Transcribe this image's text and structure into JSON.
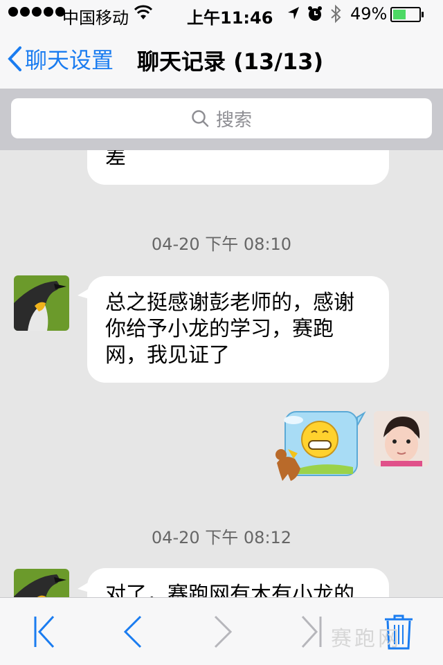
{
  "status_bar": {
    "carrier": "中国移动",
    "time": "上午11:46",
    "battery_percent": "49%",
    "battery_level": 0.49,
    "icons": [
      "signal-dots",
      "wifi-icon",
      "location-icon",
      "alarm-icon",
      "bluetooth-icon",
      "battery-icon"
    ]
  },
  "nav": {
    "back_label": "聊天设置",
    "title": "聊天记录 (13/13)"
  },
  "search": {
    "placeholder": "搜索"
  },
  "messages": [
    {
      "side": "left",
      "text": "差"
    },
    {
      "timestamp": "04-20 下午 08:10"
    },
    {
      "side": "left",
      "text": "总之挺感谢彭老师的，感谢你给予小龙的学习，赛跑网，我见证了"
    },
    {
      "side": "right",
      "type": "sticker",
      "description": "smiley-horse-sticker"
    },
    {
      "timestamp": "04-20 下午 08:12"
    },
    {
      "side": "left",
      "text": "对了，赛跑网有木有小龙的"
    }
  ],
  "toolbar": {
    "buttons": [
      "first-page",
      "previous-page",
      "next-page",
      "last-page",
      "delete"
    ]
  },
  "colors": {
    "accent": "#1a7cf0",
    "background": "#e6e6e6",
    "bubble": "#ffffff",
    "battery": "#4cd964"
  },
  "watermark": "赛跑网"
}
